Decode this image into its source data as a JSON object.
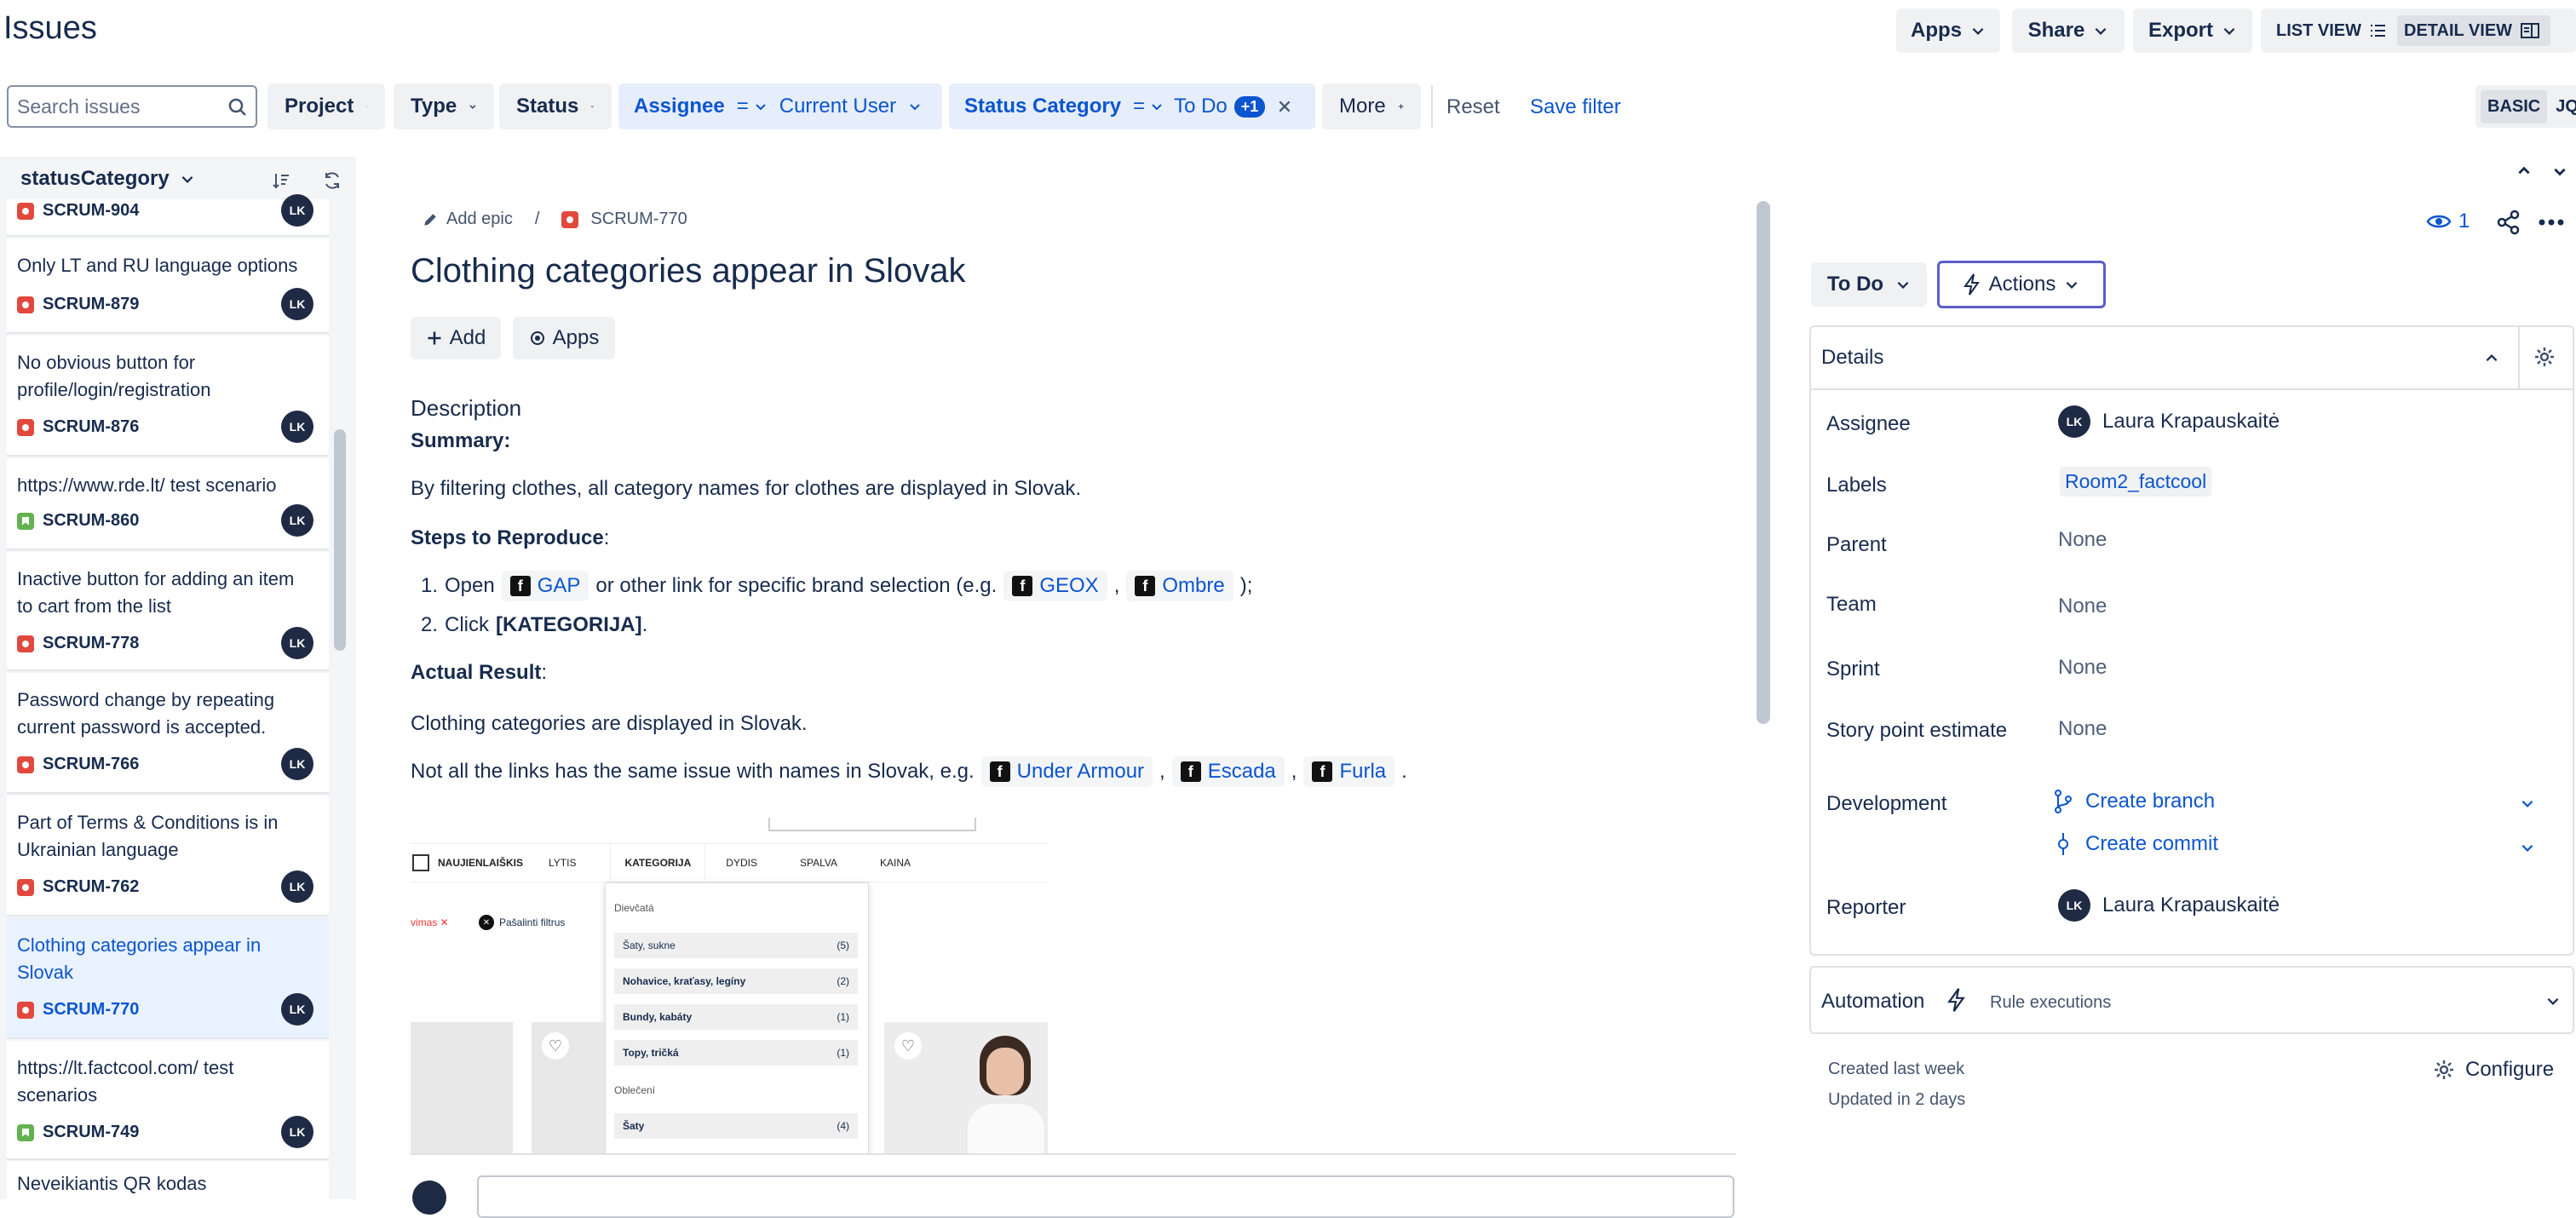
{
  "header": {
    "title": "Issues",
    "apps_label": "Apps",
    "share_label": "Share",
    "export_label": "Export",
    "list_view_label": "LIST VIEW",
    "detail_view_label": "DETAIL VIEW"
  },
  "filters": {
    "search_placeholder": "Search issues",
    "project": "Project",
    "type": "Type",
    "status": "Status",
    "assignee": "Assignee",
    "assignee_op": "=",
    "assignee_value": "Current User",
    "status_category": "Status Category",
    "status_category_op": "=",
    "status_category_value": "To Do",
    "status_category_extra": "+1",
    "more": "More",
    "reset": "Reset",
    "save_filter": "Save filter",
    "basic": "BASIC",
    "jql": "JQ"
  },
  "list": {
    "group_by": "statusCategory",
    "items": [
      {
        "title": "",
        "key": "SCRUM-904",
        "type": "bug",
        "avatar": "LK"
      },
      {
        "title": "Only LT and RU language options",
        "key": "SCRUM-879",
        "type": "bug",
        "avatar": "LK"
      },
      {
        "title": "No obvious button for profile/login/registration",
        "key": "SCRUM-876",
        "type": "bug",
        "avatar": "LK"
      },
      {
        "title": "https://www.rde.lt/ test scenario",
        "key": "SCRUM-860",
        "type": "story",
        "avatar": "LK"
      },
      {
        "title": "Inactive button for adding an item to cart from the list",
        "key": "SCRUM-778",
        "type": "bug",
        "avatar": "LK"
      },
      {
        "title": "Password change by repeating current password is accepted.",
        "key": "SCRUM-766",
        "type": "bug",
        "avatar": "LK"
      },
      {
        "title": "Part of Terms & Conditions is in Ukrainian language",
        "key": "SCRUM-762",
        "type": "bug",
        "avatar": "LK"
      },
      {
        "title": "Clothing categories appear in Slovak",
        "key": "SCRUM-770",
        "type": "bug",
        "avatar": "LK"
      },
      {
        "title": "https://lt.factcool.com/ test scenarios",
        "key": "SCRUM-749",
        "type": "story",
        "avatar": "LK"
      },
      {
        "title": "Neveikiantis QR kodas",
        "key": "",
        "type": "",
        "avatar": ""
      }
    ]
  },
  "issue": {
    "add_epic": "Add epic",
    "breadcrumb_sep": "/",
    "key": "SCRUM-770",
    "title": "Clothing categories appear in Slovak",
    "add_label": "Add",
    "apps_label": "Apps",
    "description_heading": "Description",
    "summary_label": "Summary:",
    "summary_text": "By filtering clothes, all category names for clothes are displayed in Slovak.",
    "steps_label": "Steps to Reproduce",
    "steps_colon": ":",
    "step1_a": "Open",
    "step1_link1": "GAP",
    "step1_b": "or other link for specific brand selection (e.g.",
    "step1_link2": "GEOX",
    "comma": ",",
    "step1_link3": "Ombre",
    "step1_end": ");",
    "step2_a": "Click",
    "step2_b": "[KATEGORIJA]",
    "step2_end": ".",
    "num1": "1.",
    "num2": "2.",
    "actual_label": "Actual Result",
    "actual_colon": ":",
    "actual_text": "Clothing categories are displayed in Slovak.",
    "links_text": "Not all the links has the same issue with names in Slovak, e.g.",
    "link_ua": "Under Armour",
    "link_escada": "Escada",
    "link_furla": "Furla",
    "period": "."
  },
  "screenshot": {
    "nav": [
      "NAUJIENLAIŠKIS",
      "LYTIS",
      "KATEGORIJA",
      "DYDIS",
      "SPALVA",
      "KAINA"
    ],
    "filter_tag": "vimas",
    "remove_filters": "Pašalinti filtrus",
    "group1": "Dievčatá",
    "rows": [
      {
        "label": "Šaty, sukne",
        "count": "(5)"
      },
      {
        "label": "Nohavice, kraťasy, legíny",
        "count": "(2)"
      },
      {
        "label": "Bundy, kabáty",
        "count": "(1)"
      },
      {
        "label": "Topy, tričká",
        "count": "(1)"
      }
    ],
    "group2": "Oblečení",
    "row5": {
      "label": "Šaty",
      "count": "(4)"
    }
  },
  "sidebar": {
    "watchers": "1",
    "status": "To Do",
    "actions": "Actions",
    "details_heading": "Details",
    "assignee_label": "Assignee",
    "assignee_value": "Laura Krapauskaitė",
    "labels_label": "Labels",
    "labels_value": "Room2_factcool",
    "parent_label": "Parent",
    "parent_value": "None",
    "team_label": "Team",
    "team_value": "None",
    "sprint_label": "Sprint",
    "sprint_value": "None",
    "story_points_label": "Story point estimate",
    "story_points_value": "None",
    "development_label": "Development",
    "create_branch": "Create branch",
    "create_commit": "Create commit",
    "reporter_label": "Reporter",
    "reporter_value": "Laura Krapauskaitė",
    "automation_label": "Automation",
    "rule_executions": "Rule executions",
    "created": "Created last week",
    "updated": "Updated in 2 days",
    "configure": "Configure",
    "avatar_initials": "LK"
  },
  "colors": {
    "accent": "#0b55cf",
    "bug": "#e2483d",
    "story": "#62b34f",
    "avatar": "#1f2a44"
  }
}
